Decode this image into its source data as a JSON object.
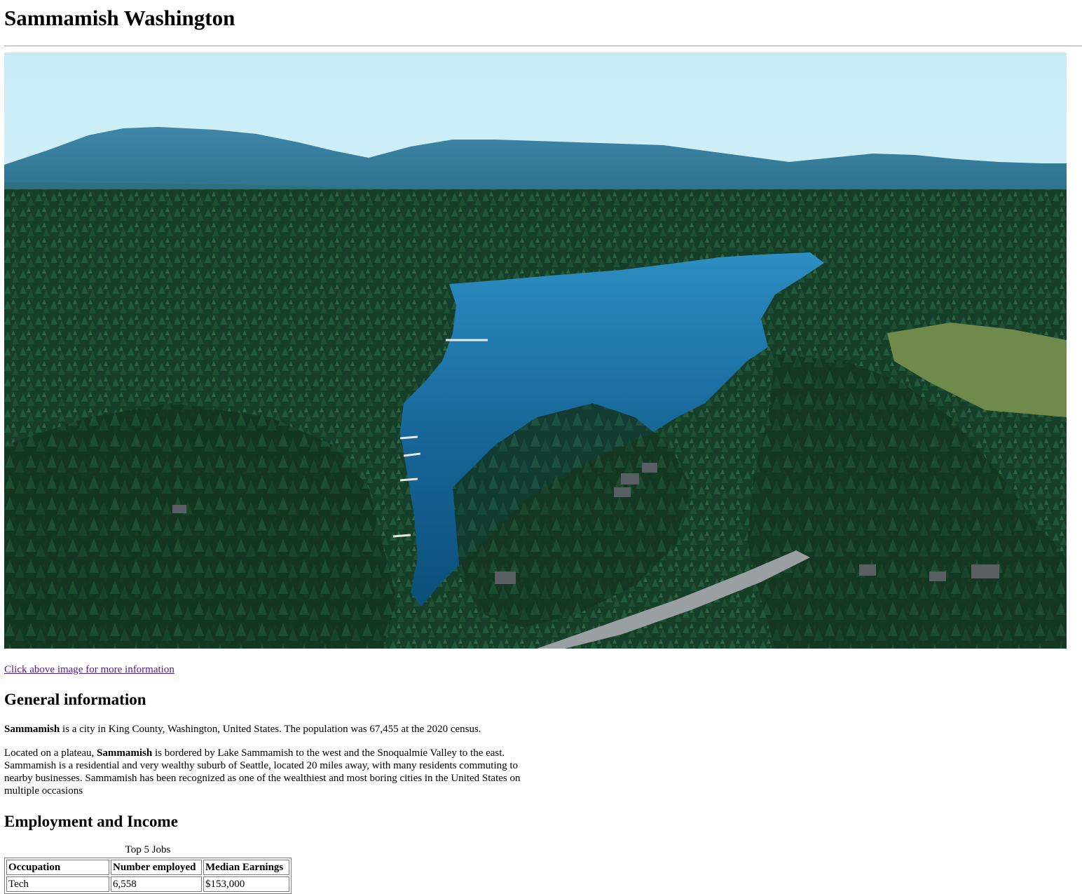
{
  "page": {
    "title": "Sammamish Washington",
    "image_alt": "Aerial view of Sammamish lake and forest",
    "image_link_text": "Click above image for more information"
  },
  "general": {
    "heading": "General information",
    "p1_name": "Sammamish",
    "p1_rest": " is a city in King County, Washington, United States. The population was 67,455 at the 2020 census.",
    "p2_before": "Located on a plateau, ",
    "p2_name": "Sammamish",
    "p2_rest": " is bordered by Lake Sammamish to the west and the Snoqualmie Valley to the east. Sammamish is a residential and very wealthy suburb of Seattle, located 20 miles away, with many residents commuting to nearby businesses. Sammamish has been recognized as one of the wealthiest and most boring cities in the United States on multiple occasions"
  },
  "employment": {
    "heading": "Employment and Income",
    "table": {
      "caption": "Top 5 Jobs",
      "headers": [
        "Occupation",
        "Number employed",
        "Median Earnings"
      ],
      "rows": [
        [
          "Tech",
          "6,558",
          "$153,000"
        ]
      ]
    }
  }
}
